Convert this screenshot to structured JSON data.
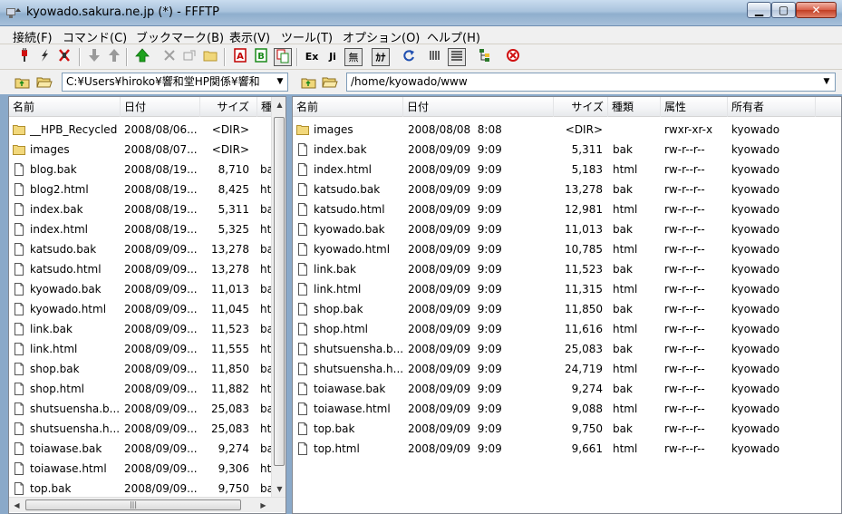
{
  "window": {
    "title": "kyowado.sakura.ne.jp (*) - FFFTP"
  },
  "menu": [
    "接続(F)",
    "コマンド(C)",
    "ブックマーク(B)",
    "表示(V)",
    "ツール(T)",
    "オプション(O)",
    "ヘルプ(H)"
  ],
  "toolbar": {
    "exec_label": "Ex",
    "jis_label": "Ji",
    "none_label": "無",
    "kana_label": "ｶﾅ",
    "ascii_a": "A",
    "binary_b": "B"
  },
  "local": {
    "path": "C:¥Users¥hiroko¥響和堂HP関係¥響和",
    "columns": [
      "名前",
      "日付",
      "サイズ",
      "種"
    ],
    "files": [
      {
        "name": "__HPB_Recycled",
        "date": "2008/08/06...",
        "size": "<DIR>",
        "type": "",
        "icon": "folder"
      },
      {
        "name": "images",
        "date": "2008/08/07...",
        "size": "<DIR>",
        "type": "",
        "icon": "folder"
      },
      {
        "name": "blog.bak",
        "date": "2008/08/19...",
        "size": "8,710",
        "type": "ba",
        "icon": "file"
      },
      {
        "name": "blog2.html",
        "date": "2008/08/19...",
        "size": "8,425",
        "type": "ht",
        "icon": "file"
      },
      {
        "name": "index.bak",
        "date": "2008/08/19...",
        "size": "5,311",
        "type": "ba",
        "icon": "file"
      },
      {
        "name": "index.html",
        "date": "2008/08/19...",
        "size": "5,325",
        "type": "ht",
        "icon": "file"
      },
      {
        "name": "katsudo.bak",
        "date": "2008/09/09...",
        "size": "13,278",
        "type": "ba",
        "icon": "file"
      },
      {
        "name": "katsudo.html",
        "date": "2008/09/09...",
        "size": "13,278",
        "type": "ht",
        "icon": "file"
      },
      {
        "name": "kyowado.bak",
        "date": "2008/09/09...",
        "size": "11,013",
        "type": "ba",
        "icon": "file"
      },
      {
        "name": "kyowado.html",
        "date": "2008/09/09...",
        "size": "11,045",
        "type": "ht",
        "icon": "file"
      },
      {
        "name": "link.bak",
        "date": "2008/09/09...",
        "size": "11,523",
        "type": "ba",
        "icon": "file"
      },
      {
        "name": "link.html",
        "date": "2008/09/09...",
        "size": "11,555",
        "type": "ht",
        "icon": "file"
      },
      {
        "name": "shop.bak",
        "date": "2008/09/09...",
        "size": "11,850",
        "type": "ba",
        "icon": "file"
      },
      {
        "name": "shop.html",
        "date": "2008/09/09...",
        "size": "11,882",
        "type": "ht",
        "icon": "file"
      },
      {
        "name": "shutsuensha.b...",
        "date": "2008/09/09...",
        "size": "25,083",
        "type": "ba",
        "icon": "file"
      },
      {
        "name": "shutsuensha.h...",
        "date": "2008/09/09...",
        "size": "25,083",
        "type": "ht",
        "icon": "file"
      },
      {
        "name": "toiawase.bak",
        "date": "2008/09/09...",
        "size": "9,274",
        "type": "ba",
        "icon": "file"
      },
      {
        "name": "toiawase.html",
        "date": "2008/09/09...",
        "size": "9,306",
        "type": "ht",
        "icon": "file"
      },
      {
        "name": "top.bak",
        "date": "2008/09/09...",
        "size": "9,750",
        "type": "ba",
        "icon": "file"
      }
    ]
  },
  "remote": {
    "path": "/home/kyowado/www",
    "columns": [
      "名前",
      "日付",
      "サイズ",
      "種類",
      "属性",
      "所有者"
    ],
    "files": [
      {
        "name": "images",
        "date": "2008/08/08  8:08",
        "size": "<DIR>",
        "type": "",
        "attr": "rwxr-xr-x",
        "owner": "kyowado",
        "icon": "folder"
      },
      {
        "name": "index.bak",
        "date": "2008/09/09  9:09",
        "size": "5,311",
        "type": "bak",
        "attr": "rw-r--r--",
        "owner": "kyowado",
        "icon": "file"
      },
      {
        "name": "index.html",
        "date": "2008/09/09  9:09",
        "size": "5,183",
        "type": "html",
        "attr": "rw-r--r--",
        "owner": "kyowado",
        "icon": "file"
      },
      {
        "name": "katsudo.bak",
        "date": "2008/09/09  9:09",
        "size": "13,278",
        "type": "bak",
        "attr": "rw-r--r--",
        "owner": "kyowado",
        "icon": "file"
      },
      {
        "name": "katsudo.html",
        "date": "2008/09/09  9:09",
        "size": "12,981",
        "type": "html",
        "attr": "rw-r--r--",
        "owner": "kyowado",
        "icon": "file"
      },
      {
        "name": "kyowado.bak",
        "date": "2008/09/09  9:09",
        "size": "11,013",
        "type": "bak",
        "attr": "rw-r--r--",
        "owner": "kyowado",
        "icon": "file"
      },
      {
        "name": "kyowado.html",
        "date": "2008/09/09  9:09",
        "size": "10,785",
        "type": "html",
        "attr": "rw-r--r--",
        "owner": "kyowado",
        "icon": "file"
      },
      {
        "name": "link.bak",
        "date": "2008/09/09  9:09",
        "size": "11,523",
        "type": "bak",
        "attr": "rw-r--r--",
        "owner": "kyowado",
        "icon": "file"
      },
      {
        "name": "link.html",
        "date": "2008/09/09  9:09",
        "size": "11,315",
        "type": "html",
        "attr": "rw-r--r--",
        "owner": "kyowado",
        "icon": "file"
      },
      {
        "name": "shop.bak",
        "date": "2008/09/09  9:09",
        "size": "11,850",
        "type": "bak",
        "attr": "rw-r--r--",
        "owner": "kyowado",
        "icon": "file"
      },
      {
        "name": "shop.html",
        "date": "2008/09/09  9:09",
        "size": "11,616",
        "type": "html",
        "attr": "rw-r--r--",
        "owner": "kyowado",
        "icon": "file"
      },
      {
        "name": "shutsuensha.b...",
        "date": "2008/09/09  9:09",
        "size": "25,083",
        "type": "bak",
        "attr": "rw-r--r--",
        "owner": "kyowado",
        "icon": "file"
      },
      {
        "name": "shutsuensha.h...",
        "date": "2008/09/09  9:09",
        "size": "24,719",
        "type": "html",
        "attr": "rw-r--r--",
        "owner": "kyowado",
        "icon": "file"
      },
      {
        "name": "toiawase.bak",
        "date": "2008/09/09  9:09",
        "size": "9,274",
        "type": "bak",
        "attr": "rw-r--r--",
        "owner": "kyowado",
        "icon": "file"
      },
      {
        "name": "toiawase.html",
        "date": "2008/09/09  9:09",
        "size": "9,088",
        "type": "html",
        "attr": "rw-r--r--",
        "owner": "kyowado",
        "icon": "file"
      },
      {
        "name": "top.bak",
        "date": "2008/09/09  9:09",
        "size": "9,750",
        "type": "bak",
        "attr": "rw-r--r--",
        "owner": "kyowado",
        "icon": "file"
      },
      {
        "name": "top.html",
        "date": "2008/09/09  9:09",
        "size": "9,661",
        "type": "html",
        "attr": "rw-r--r--",
        "owner": "kyowado",
        "icon": "file"
      }
    ]
  }
}
